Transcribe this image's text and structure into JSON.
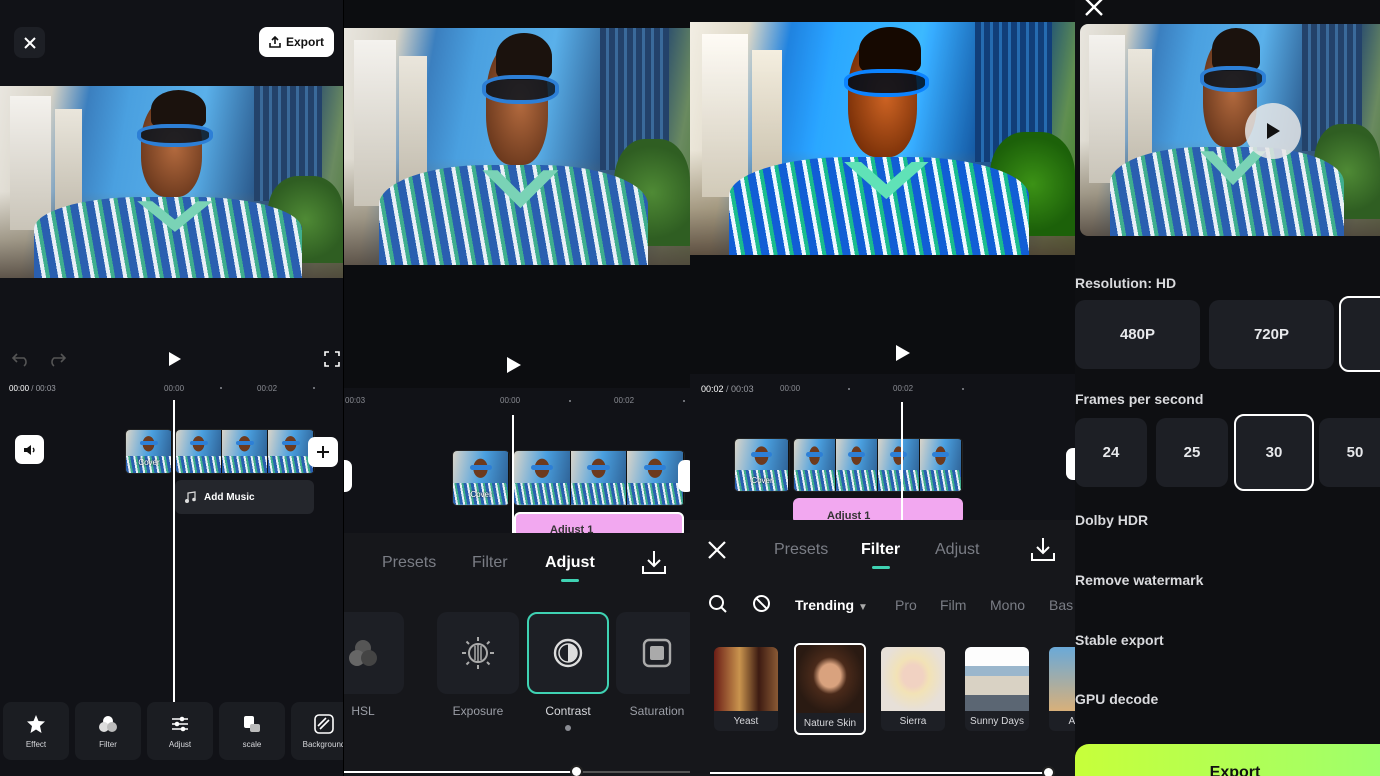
{
  "panel1": {
    "close_icon": "close-icon",
    "export_label": "Export",
    "timecode_current": "00:00",
    "timecode_total": "/ 00:03",
    "ruler": [
      "00:00",
      "00:02"
    ],
    "cover_label": "Cover",
    "add_music_label": "Add Music",
    "tools": [
      "Effect",
      "Filter",
      "Adjust",
      "scale",
      "Background"
    ]
  },
  "panel2": {
    "ruler": [
      "00:03",
      "00:00",
      "00:02"
    ],
    "cover_label": "Cover",
    "adjust_clip_label": "Adjust 1",
    "tabs": [
      "Presets",
      "Filter",
      "Adjust"
    ],
    "active_tab": "Adjust",
    "adjust_items": [
      "HSL",
      "Exposure",
      "Contrast",
      "Saturation"
    ],
    "selected_item": "Contrast",
    "slider_value": 0.67
  },
  "panel3": {
    "timecode_current": "00:02",
    "timecode_total": "/ 00:03",
    "ruler": [
      "00:00",
      "00:02"
    ],
    "cover_label": "Cover",
    "adjust_clip_label": "Adjust 1",
    "tabs": [
      "Presets",
      "Filter",
      "Adjust"
    ],
    "active_tab": "Filter",
    "categories": [
      "Trending",
      "Pro",
      "Film",
      "Mono",
      "Bas"
    ],
    "filters": [
      "Yeast",
      "Nature Skin",
      "Sierra",
      "Sunny Days",
      "AI Co"
    ],
    "selected_filter": "Nature Skin",
    "slider_value": 0.98
  },
  "panel4": {
    "resolution_label": "Resolution: HD",
    "resolutions": [
      "480P",
      "720P"
    ],
    "fps_label": "Frames per second",
    "fps": [
      "24",
      "25",
      "30",
      "50"
    ],
    "selected_fps": "30",
    "dolby_label": "Dolby HDR",
    "watermark_label": "Remove watermark",
    "stable_label": "Stable export",
    "gpu_label": "GPU decode",
    "export_label": "Export"
  },
  "colors": {
    "accent": "#3fd2b3",
    "adjust_clip": "#f2a8f0",
    "export_green": "#b8ff4a"
  }
}
